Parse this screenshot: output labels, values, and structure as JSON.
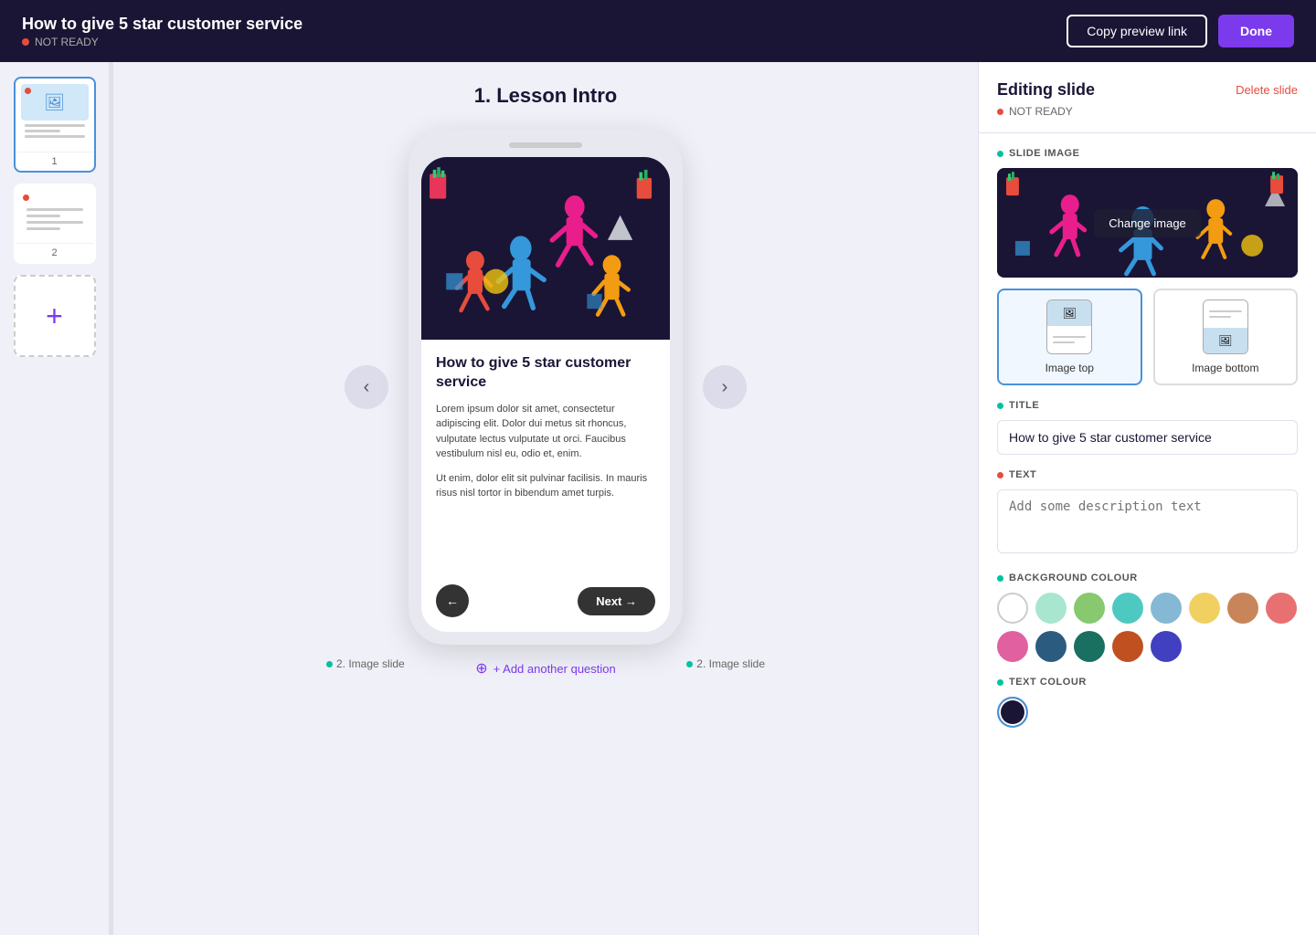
{
  "header": {
    "title": "How to give 5 star customer service",
    "status": "NOT READY",
    "copy_preview_label": "Copy preview link",
    "done_label": "Done"
  },
  "sidebar": {
    "slides": [
      {
        "number": "1",
        "type": "image-text",
        "active": true
      },
      {
        "number": "2",
        "type": "text-only",
        "active": false
      }
    ],
    "add_slide_label": "+"
  },
  "canvas": {
    "lesson_title": "1.  Lesson Intro",
    "nav_left_label": "2. Image slide",
    "nav_right_label": "2. Image slide",
    "phone_heading": "How to give 5 star customer service",
    "phone_body_1": "Lorem ipsum dolor sit amet, consectetur adipiscing elit. Dolor dui metus sit rhoncus, vulputate lectus vulputate ut orci. Faucibus vestibulum nisl eu, odio et, enim.",
    "phone_body_2": "Ut enim, dolor elit sit pulvinar facilisis. In mauris risus nisl tortor in bibendum amet turpis.",
    "btn_next_label": "Next →",
    "btn_back_label": "←",
    "add_question_label": "+ Add another question"
  },
  "right_panel": {
    "title": "Editing slide",
    "status": "NOT READY",
    "delete_label": "Delete slide",
    "slide_image_section": "SLIDE IMAGE",
    "change_image_label": "Change image",
    "layout_top_label": "Image top",
    "layout_bottom_label": "Image bottom",
    "title_section": "TITLE",
    "title_value": "How to give 5 star customer service",
    "title_placeholder": "How to give 5 star customer service",
    "text_section": "TEXT",
    "text_placeholder": "Add some description text",
    "bg_colour_section": "BACKGROUND COLOUR",
    "text_colour_section": "TEXT COLOUR",
    "bg_colours": [
      {
        "hex": "#ffffff",
        "selected": true
      },
      {
        "hex": "#a8e6cf"
      },
      {
        "hex": "#88c86e"
      },
      {
        "hex": "#4ec9c2"
      },
      {
        "hex": "#85b8d4"
      },
      {
        "hex": "#f0d060"
      },
      {
        "hex": "#c9855a"
      },
      {
        "hex": "#e87070"
      },
      {
        "hex": "#e060a0"
      },
      {
        "hex": "#2b5c80"
      },
      {
        "hex": "#1a7060"
      },
      {
        "hex": "#c05020"
      },
      {
        "hex": "#4040c0"
      }
    ]
  }
}
